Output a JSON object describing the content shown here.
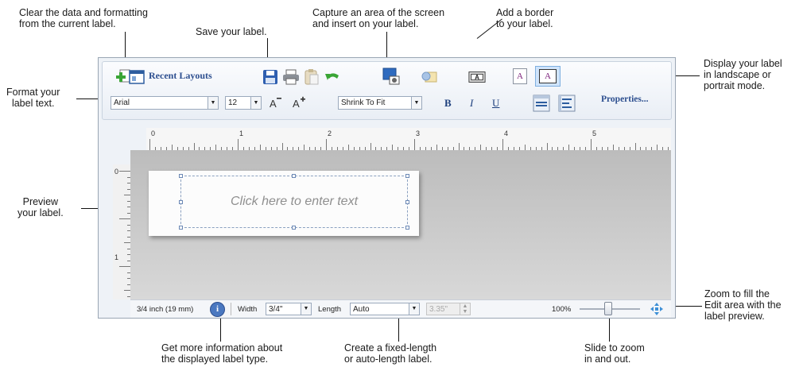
{
  "callouts": {
    "clear": "Clear the data and formatting\nfrom the current label.",
    "save": "Save your label.",
    "capture": "Capture an area of the screen\nand insert on your label.",
    "border": "Add a border\nto your label.",
    "display": "Display your label\nin landscape or\nportrait mode.",
    "format": "Format your\nlabel text.",
    "preview": "Preview\nyour label.",
    "zoom_fill": "Zoom to fill the\nEdit area with the\nlabel preview.",
    "more_info": "Get more information about\nthe displayed label type.",
    "fixed_length": "Create a fixed-length\nor auto-length label.",
    "slide_zoom": "Slide to zoom\nin and out."
  },
  "toolbar": {
    "recent_layouts": "Recent Layouts",
    "font_name": "Arial",
    "font_size": "12",
    "fit_mode": "Shrink To Fit",
    "bold": "B",
    "italic": "I",
    "underline": "U",
    "properties": "Properties...",
    "orient_landscape": "A",
    "orient_portrait": "A",
    "border_glyph": "A"
  },
  "ruler": {
    "h_labels": [
      "0",
      "1",
      "2",
      "3",
      "4",
      "5"
    ],
    "v_labels": [
      "0",
      "1"
    ]
  },
  "label": {
    "placeholder": "Click here to enter text"
  },
  "statusbar": {
    "label_type": "3/4 inch (19 mm)",
    "width_label": "Width",
    "width_value": "3/4\"",
    "length_label": "Length",
    "length_value": "Auto",
    "fixed_length_value": "3.35\"",
    "zoom": "100%"
  },
  "colors": {
    "accent_blue": "#2d4f8f",
    "green_plus": "#3aa535"
  }
}
